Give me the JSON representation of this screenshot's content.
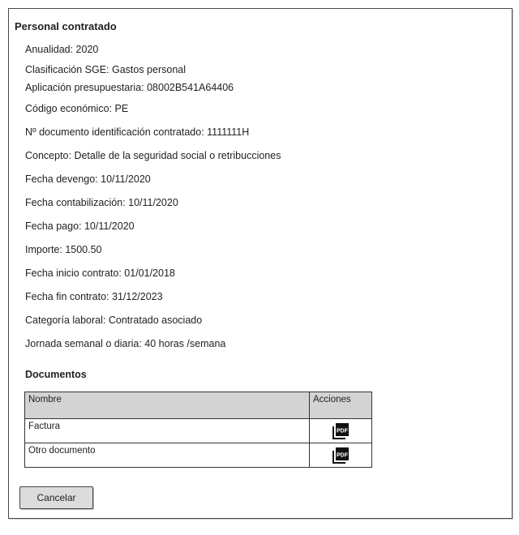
{
  "panel": {
    "title": "Personal contratado",
    "fields": [
      "Anualidad: 2020",
      "Clasificación SGE: Gastos personal",
      "Aplicación presupuestaria: 08002B541A64406",
      "Código económico: PE",
      "Nº documento identificación contratado: 1111111H",
      "Concepto: Detalle de la seguridad social o retribucciones",
      "Fecha devengo: 10/11/2020",
      "Fecha contabilización: 10/11/2020",
      "Fecha pago: 10/11/2020",
      "Importe: 1500.50",
      "Fecha inicio contrato: 01/01/2018",
      "Fecha fin contrato: 31/12/2023",
      "Categoría laboral: Contratado asociado",
      "Jornada semanal o diaria: 40 horas /semana"
    ]
  },
  "documents": {
    "heading": "Documentos",
    "columns": [
      "Nombre",
      "Acciones"
    ],
    "rows": [
      {
        "name": "Factura",
        "action_icon": "pdf-icon",
        "icon_label": "PDF"
      },
      {
        "name": "Otro documento",
        "action_icon": "pdf-icon",
        "icon_label": "PDF"
      }
    ]
  },
  "footer": {
    "cancel_label": "Cancelar"
  }
}
